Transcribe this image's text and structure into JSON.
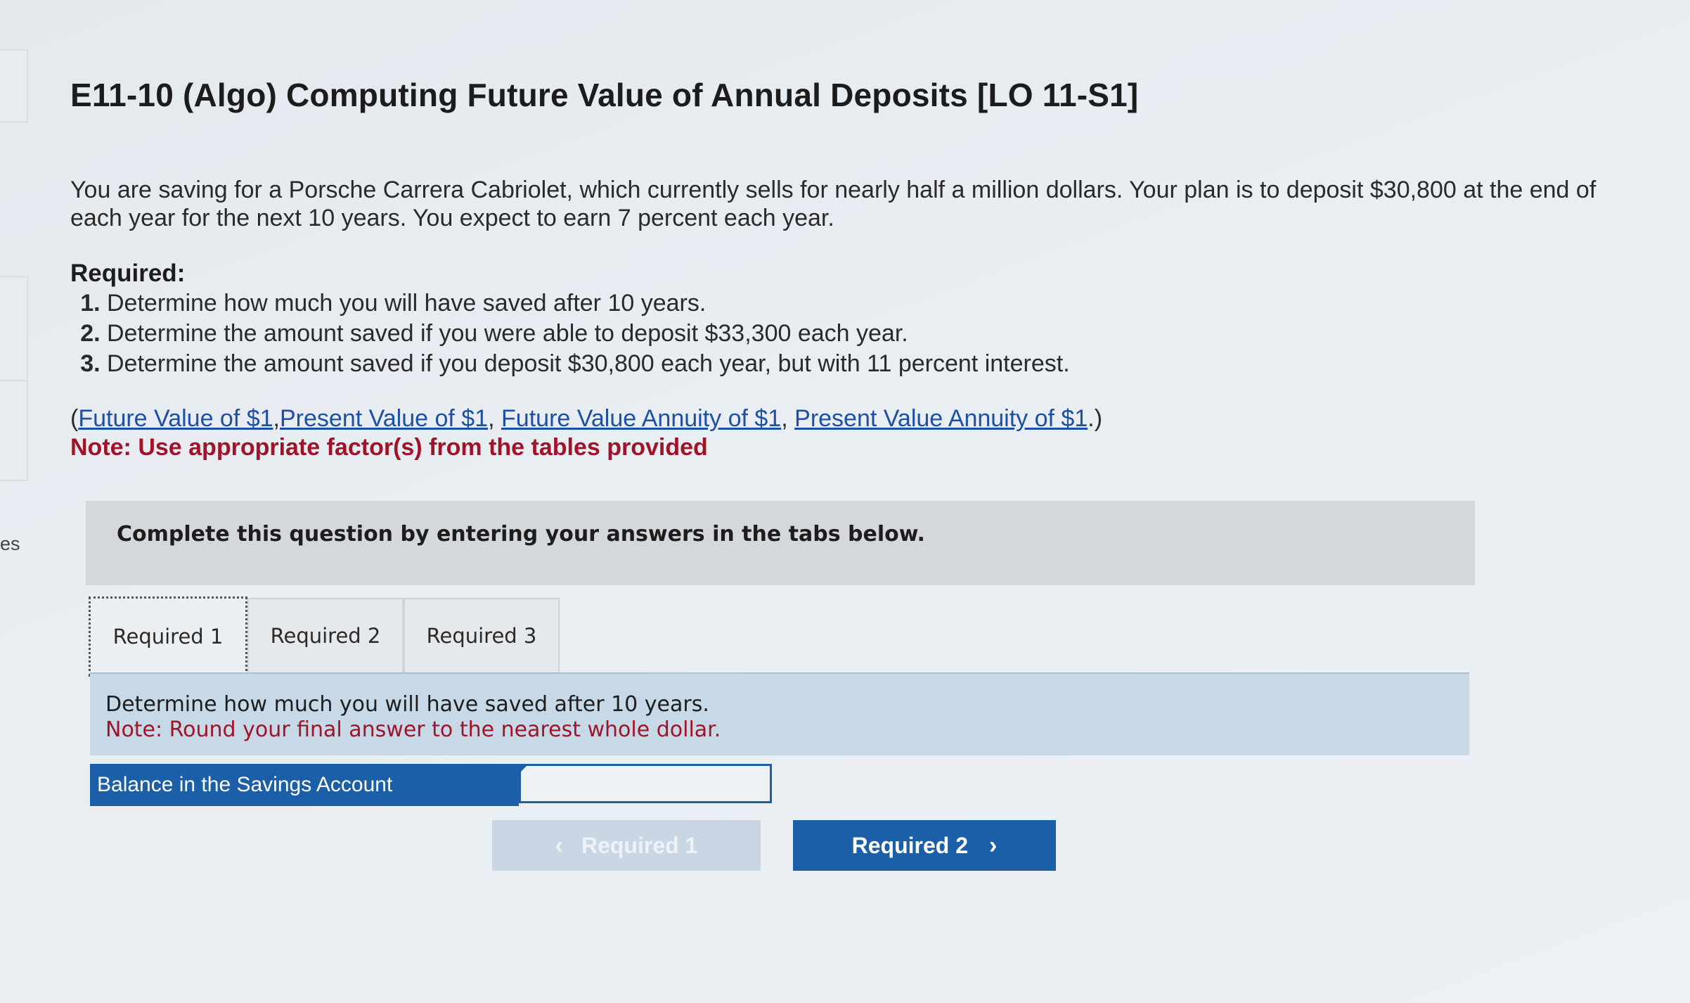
{
  "sidebar_fragment": {
    "label": "es"
  },
  "problem": {
    "title": "E11-10 (Algo) Computing Future Value of Annual Deposits [LO 11-S1]",
    "intro": "You are saving for a Porsche Carrera Cabriolet, which currently sells for nearly half a million dollars. Your plan is to deposit $30,800 at the end of each year for the next 10 years. You expect to earn 7 percent each year.",
    "required_heading": "Required:",
    "requirements": [
      "Determine how much you will have saved after 10 years.",
      "Determine the amount saved if you were able to deposit $33,300 each year.",
      "Determine the amount saved if you deposit $30,800 each year, but with 11 percent interest."
    ],
    "links": {
      "open_paren": "(",
      "fv1": "Future Value of $1",
      "sep1": ",",
      "pv1": "Present Value of $1",
      "sep2": ", ",
      "fva1": "Future Value Annuity of $1",
      "sep3": ", ",
      "pva1": "Present Value Annuity of $1",
      "close": ".)"
    },
    "note": "Note: Use appropriate factor(s) from the tables provided"
  },
  "instruction": "Complete this question by entering your answers in the tabs below.",
  "tabs": [
    {
      "label": "Required 1",
      "active": true
    },
    {
      "label": "Required 2",
      "active": false
    },
    {
      "label": "Required 3",
      "active": false
    }
  ],
  "panel": {
    "question": "Determine how much you will have saved after 10 years.",
    "note": "Note: Round your final answer to the nearest whole dollar."
  },
  "answer": {
    "label": "Balance in the Savings Account",
    "value": ""
  },
  "navigation": {
    "prev_label": "Required 1",
    "prev_icon": "chevron-left-icon",
    "next_label": "Required 2",
    "next_icon": "chevron-right-icon",
    "prev_enabled": false
  },
  "colors": {
    "accent": "#1b5fa8",
    "note_red": "#a0142a",
    "link": "#1e4fa3",
    "panel_bg": "#c7d8e6"
  }
}
